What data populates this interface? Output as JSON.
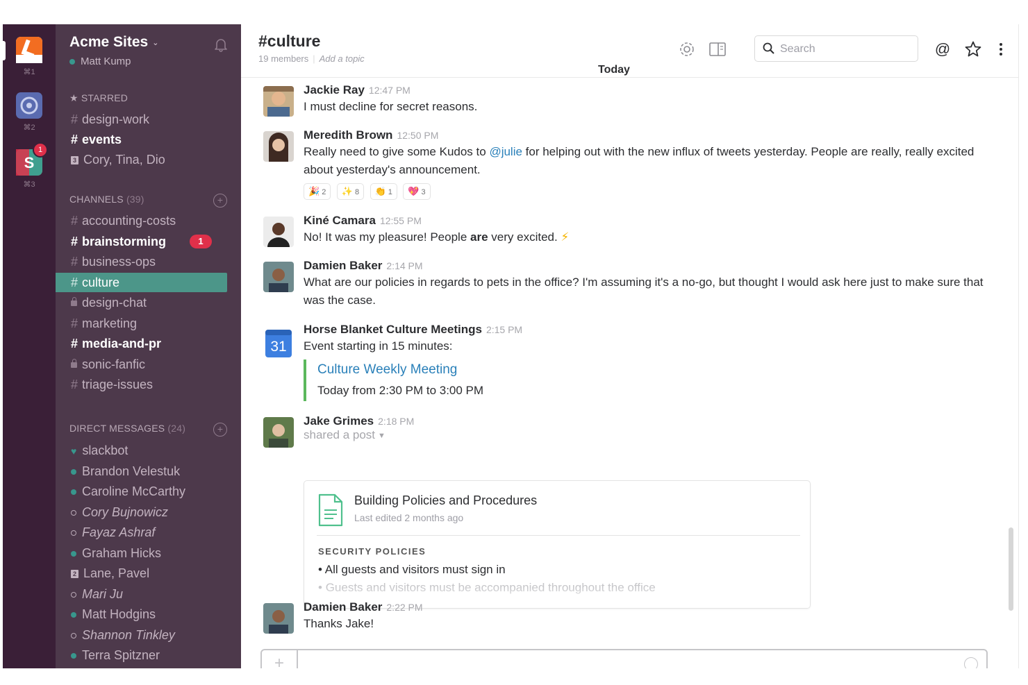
{
  "rail": {
    "teams": [
      {
        "key": "⌘1",
        "color": "#f26d21"
      },
      {
        "key": "⌘2",
        "color": "#5a6bb0"
      },
      {
        "key": "⌘3",
        "color": "#e0304a",
        "badge": "1"
      }
    ]
  },
  "sidebar": {
    "team_name": "Acme Sites",
    "user_name": "Matt Kump",
    "starred_label": "STARRED",
    "starred": [
      {
        "label": "design-work"
      },
      {
        "label": "events"
      },
      {
        "label": "Cory, Tina, Dio"
      }
    ],
    "channels_label": "CHANNELS",
    "channels_count": "(39)",
    "channels": [
      {
        "label": "accounting-costs"
      },
      {
        "label": "brainstorming",
        "badge": "1"
      },
      {
        "label": "business-ops"
      },
      {
        "label": "culture"
      },
      {
        "label": "design-chat"
      },
      {
        "label": "marketing"
      },
      {
        "label": "media-and-pr"
      },
      {
        "label": "sonic-fanfic"
      },
      {
        "label": "triage-issues"
      }
    ],
    "dm_label": "DIRECT MESSAGES",
    "dm_count": "(24)",
    "dms": [
      {
        "label": "slackbot"
      },
      {
        "label": "Brandon Velestuk"
      },
      {
        "label": "Caroline McCarthy"
      },
      {
        "label": "Cory Bujnowicz"
      },
      {
        "label": "Fayaz Ashraf"
      },
      {
        "label": "Graham Hicks"
      },
      {
        "label": "Lane, Pavel"
      },
      {
        "label": "Mari Ju"
      },
      {
        "label": "Matt Hodgins"
      },
      {
        "label": "Shannon Tinkley"
      },
      {
        "label": "Terra Spitzner"
      }
    ]
  },
  "header": {
    "channel": "#culture",
    "members": "19 members",
    "topic": "Add a topic",
    "search_placeholder": "Search",
    "day_divider": "Today"
  },
  "messages": [
    {
      "author": "Jackie Ray",
      "time": "12:47 PM",
      "text": "I must decline for secret reasons."
    },
    {
      "author": "Meredith Brown",
      "time": "12:50 PM",
      "text_before": "Really need to give some Kudos to ",
      "mention": "@julie",
      "text_after": " for helping out with the new influx of tweets yesterday. People are really, really excited about yesterday's announcement.",
      "reactions": [
        {
          "emoji": "🎉",
          "count": "2"
        },
        {
          "emoji": "✨",
          "count": "8"
        },
        {
          "emoji": "👏",
          "count": "1"
        },
        {
          "emoji": "💖",
          "count": "3"
        }
      ]
    },
    {
      "author": "Kiné Camara",
      "time": "12:55 PM",
      "text_before": "No! It was my pleasure! People ",
      "bold": "are",
      "text_after": " very excited. ",
      "emoji": "⚡"
    },
    {
      "author": "Damien Baker",
      "time": "2:14 PM",
      "text": "What are our policies in regards to pets in the office? I'm assuming it's a no-go, but thought I would ask here just to make sure that was the case."
    },
    {
      "author": "Horse Blanket Culture Meetings",
      "time": "2:15 PM",
      "calendar_day": "31",
      "text": "Event starting in 15 minutes:",
      "event_title": "Culture Weekly Meeting",
      "event_time": "Today from 2:30 PM to 3:00 PM"
    },
    {
      "author": "Jake Grimes",
      "time": "2:18 PM",
      "sub": "shared a post",
      "post": {
        "title": "Building Policies and Procedures",
        "edited": "Last edited 2 months ago",
        "section": "SECURITY POLICIES",
        "bullets": [
          "All guests and visitors must sign in",
          "Guests and visitors must be accompanied throughout the office"
        ]
      }
    },
    {
      "author": "Damien Baker",
      "time": "2:22 PM",
      "text": "Thanks Jake!"
    }
  ]
}
